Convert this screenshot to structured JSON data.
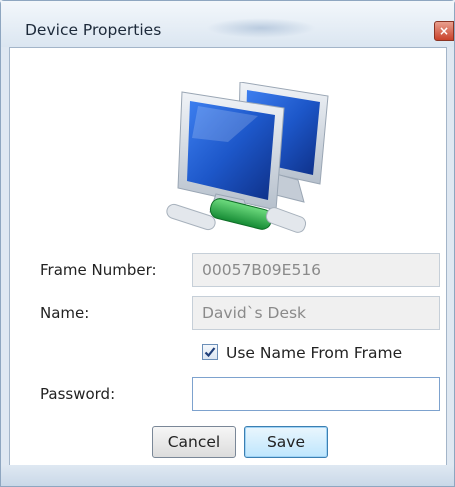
{
  "window": {
    "title": "Device Properties",
    "close_glyph": "×"
  },
  "icon": {
    "name": "network-computers-icon",
    "colors": {
      "screen": "#1d57c9",
      "cable": "#2aa84a"
    }
  },
  "form": {
    "frame_number": {
      "label": "Frame Number:",
      "value": "00057B09E516"
    },
    "name": {
      "label": "Name:",
      "value": "David`s Desk"
    },
    "use_name_from_frame": {
      "label": "Use Name From Frame",
      "checked": true
    },
    "password": {
      "label": "Password:",
      "value": ""
    }
  },
  "buttons": {
    "cancel": "Cancel",
    "save": "Save"
  }
}
